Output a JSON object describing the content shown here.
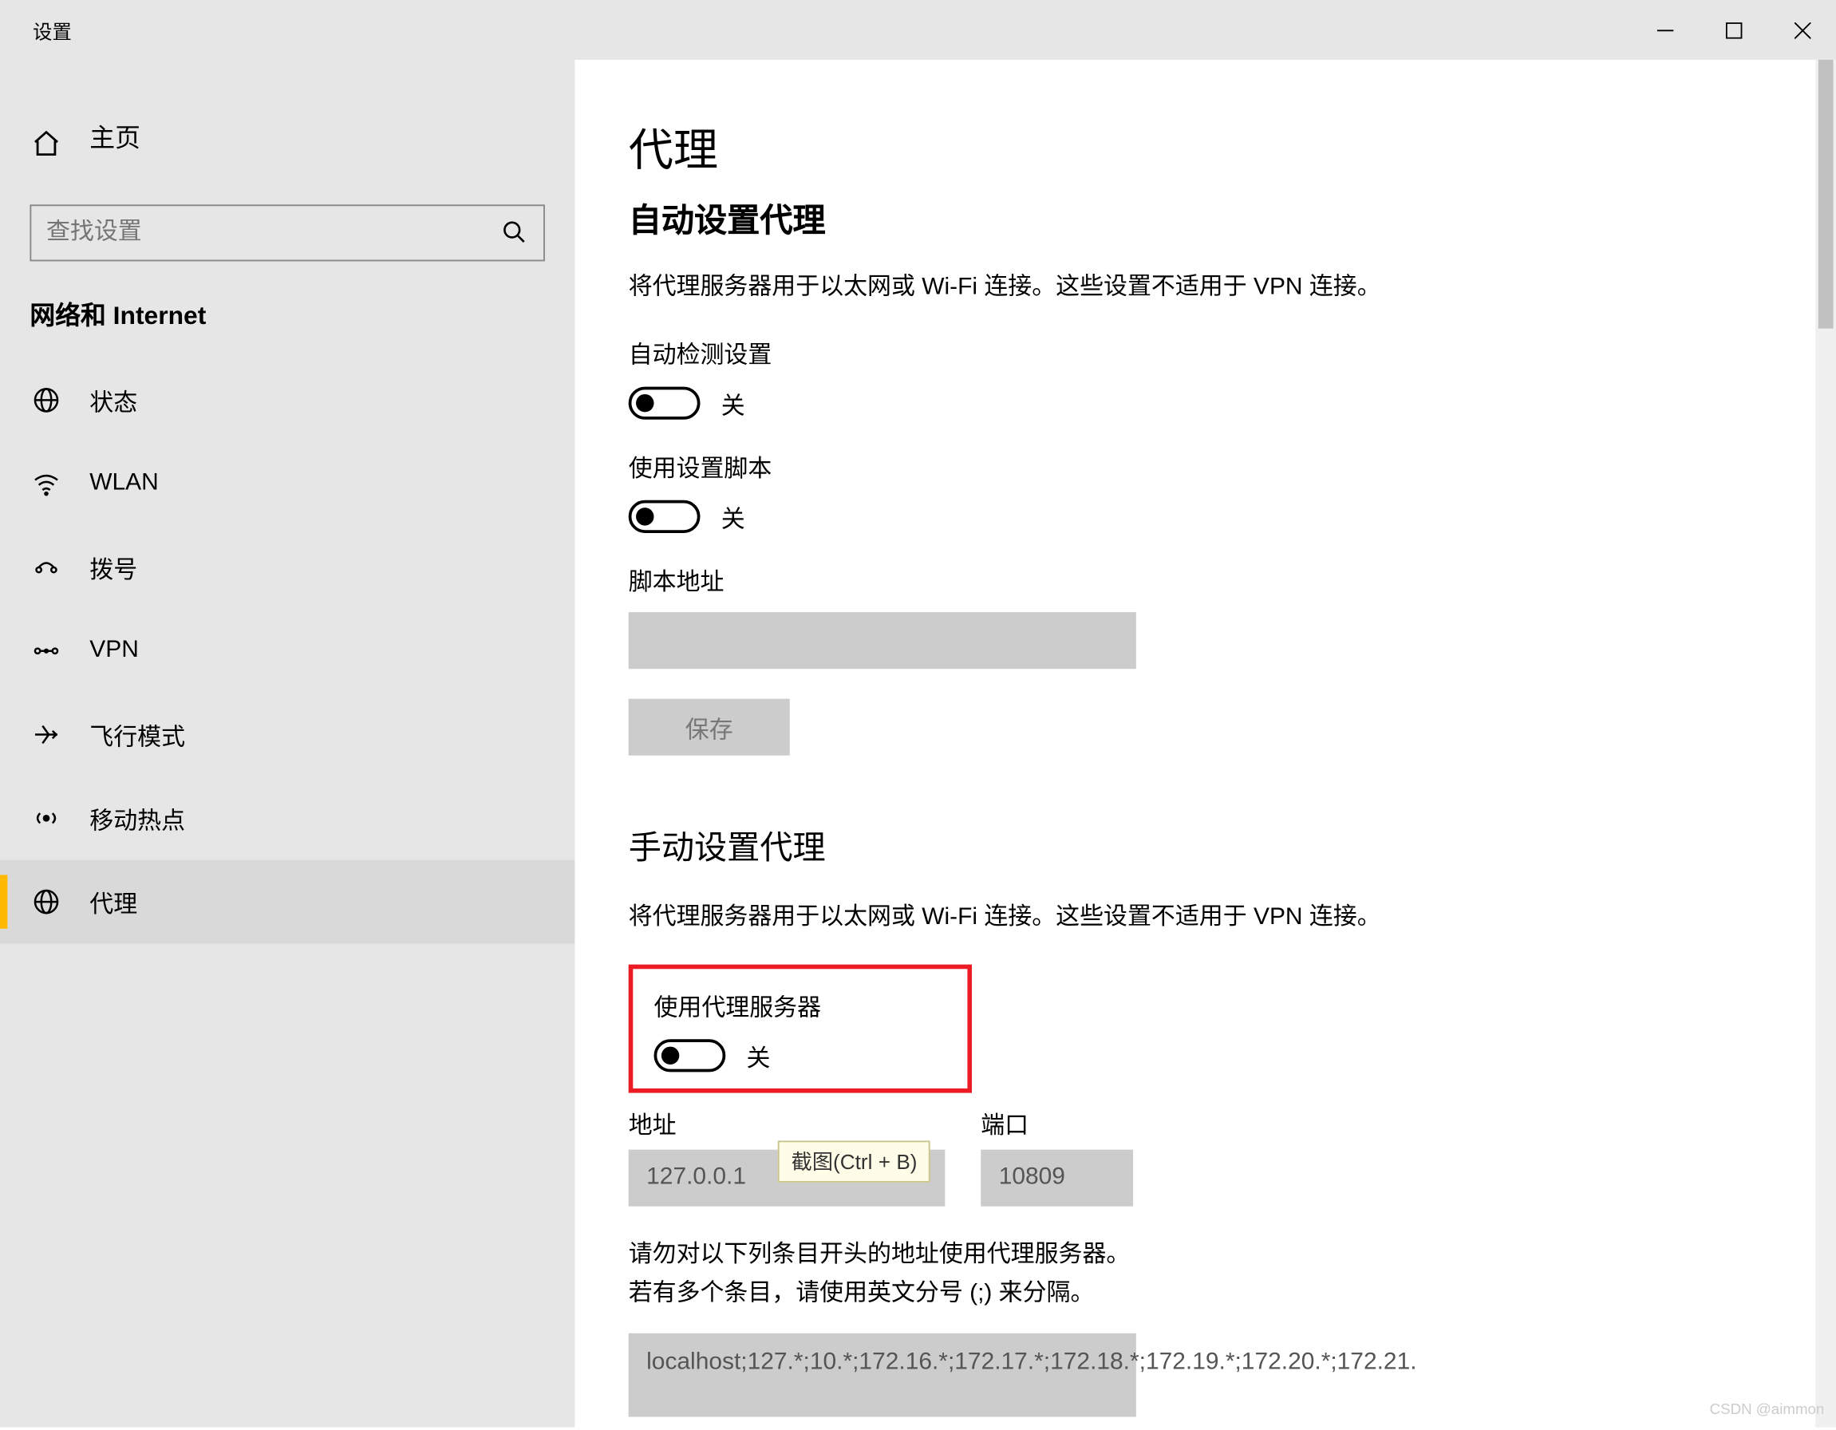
{
  "window": {
    "title": "设置"
  },
  "sidebar": {
    "home_label": "主页",
    "search_placeholder": "查找设置",
    "section_title": "网络和 Internet",
    "items": [
      {
        "label": "状态"
      },
      {
        "label": "WLAN"
      },
      {
        "label": "拨号"
      },
      {
        "label": "VPN"
      },
      {
        "label": "飞行模式"
      },
      {
        "label": "移动热点"
      },
      {
        "label": "代理"
      }
    ]
  },
  "content": {
    "page_title": "代理",
    "auto": {
      "heading": "自动设置代理",
      "desc": "将代理服务器用于以太网或 Wi-Fi 连接。这些设置不适用于 VPN 连接。",
      "auto_detect_label": "自动检测设置",
      "auto_detect_state": "关",
      "use_script_label": "使用设置脚本",
      "use_script_state": "关",
      "script_addr_label": "脚本地址",
      "script_addr_value": "",
      "save_label": "保存"
    },
    "manual": {
      "heading": "手动设置代理",
      "desc": "将代理服务器用于以太网或 Wi-Fi 连接。这些设置不适用于 VPN 连接。",
      "use_proxy_label": "使用代理服务器",
      "use_proxy_state": "关",
      "addr_label": "地址",
      "addr_value": "127.0.0.1",
      "port_label": "端口",
      "port_value": "10809",
      "bypass_desc": "请勿对以下列条目开头的地址使用代理服务器。若有多个条目，请使用英文分号 (;) 来分隔。",
      "bypass_value": "localhost;127.*;10.*;172.16.*;172.17.*;172.18.*;172.19.*;172.20.*;172.21."
    },
    "tooltip": "截图(Ctrl + B)"
  },
  "watermark": "CSDN @aimmon"
}
